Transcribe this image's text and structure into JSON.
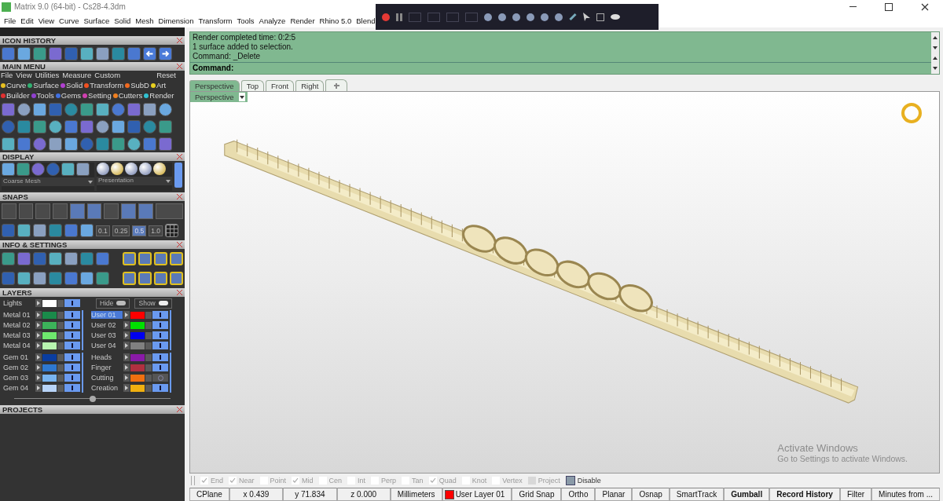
{
  "window": {
    "title": "Matrix 9.0 (64-bit) - Cs28-4.3dm"
  },
  "menu": [
    "File",
    "Edit",
    "View",
    "Curve",
    "Surface",
    "Solid",
    "Mesh",
    "Dimension",
    "Transform",
    "Tools",
    "Analyze",
    "Render",
    "Rhino 5.0",
    "Blend"
  ],
  "panels": {
    "icon_history": "ICON HISTORY",
    "main_menu": "MAIN MENU",
    "display": "DISPLAY",
    "snaps": "SNAPS",
    "info": "INFO & SETTINGS",
    "layers": "LAYERS",
    "projects": "PROJECTS"
  },
  "main_menu": {
    "submenu": [
      "File",
      "View",
      "Utilities",
      "Measure",
      "Custom"
    ],
    "reset": "Reset",
    "categories": [
      {
        "label": "Curve",
        "color": "#e8c020"
      },
      {
        "label": "Surface",
        "color": "#30b070"
      },
      {
        "label": "Solid",
        "color": "#b040d0"
      },
      {
        "label": "Transform",
        "color": "#f05020"
      },
      {
        "label": "SubD",
        "color": "#f06a20"
      },
      {
        "label": "Art",
        "color": "#e8d020"
      },
      {
        "label": "Builder",
        "color": "#e03030"
      },
      {
        "label": "Tools",
        "color": "#9040d0"
      },
      {
        "label": "Gems",
        "color": "#4070e0"
      },
      {
        "label": "Setting",
        "color": "#d040b0"
      },
      {
        "label": "Cutters",
        "color": "#f08020"
      },
      {
        "label": "Render",
        "color": "#30c0d0"
      }
    ]
  },
  "display": {
    "mesh": "Coarse Mesh",
    "mode": "Presentation"
  },
  "snaps": {
    "values": [
      {
        "label": "0.1",
        "selected": false
      },
      {
        "label": "0.25",
        "selected": false
      },
      {
        "label": "0.5",
        "selected": true
      },
      {
        "label": "1.0",
        "selected": false
      }
    ]
  },
  "layers": {
    "lights": {
      "name": "Lights",
      "color": "#ffffff",
      "on": true
    },
    "hide": "Hide",
    "show": "Show",
    "blocks": [
      {
        "left": [
          {
            "name": "Metal 01",
            "color": "#1a8a4a",
            "selected": false,
            "on": true
          },
          {
            "name": "Metal 02",
            "color": "#3cb35a",
            "selected": false,
            "on": true
          },
          {
            "name": "Metal 03",
            "color": "#6ee86e",
            "selected": false,
            "on": true
          },
          {
            "name": "Metal 04",
            "color": "#b8f5b0",
            "selected": false,
            "on": true
          }
        ],
        "right": [
          {
            "name": "User 01",
            "color": "#ff0000",
            "selected": true,
            "on": true
          },
          {
            "name": "User 02",
            "color": "#00e000",
            "selected": false,
            "on": true
          },
          {
            "name": "User 03",
            "color": "#0000f0",
            "selected": false,
            "on": true
          },
          {
            "name": "User 04",
            "color": "#808080",
            "selected": false,
            "on": true
          }
        ]
      },
      {
        "left": [
          {
            "name": "Gem 01",
            "color": "#0a3da0",
            "selected": false,
            "on": true
          },
          {
            "name": "Gem 02",
            "color": "#2e78d0",
            "selected": false,
            "on": true
          },
          {
            "name": "Gem 03",
            "color": "#78b4f0",
            "selected": false,
            "on": true
          },
          {
            "name": "Gem 04",
            "color": "#b8d4f8",
            "selected": false,
            "on": true
          }
        ],
        "right": [
          {
            "name": "Heads",
            "color": "#8a1aa8",
            "selected": false,
            "on": true
          },
          {
            "name": "Finger",
            "color": "#b03040",
            "selected": false,
            "on": true
          },
          {
            "name": "Cutting",
            "color": "#f07010",
            "selected": false,
            "on": false
          },
          {
            "name": "Creation",
            "color": "#f0b010",
            "selected": false,
            "on": true
          }
        ]
      }
    ]
  },
  "command": {
    "history": [
      "Render completed time: 0:2:5",
      "1 surface added to selection.",
      "Command: _Delete"
    ],
    "prompt": "Command:"
  },
  "tabs": [
    {
      "label": "Perspective",
      "selected": true
    },
    {
      "label": "Top",
      "selected": false
    },
    {
      "label": "Front",
      "selected": false
    },
    {
      "label": "Right",
      "selected": false
    }
  ],
  "viewport": {
    "label": "Perspective"
  },
  "osnaps": [
    {
      "label": "End",
      "kind": "osnap",
      "checked": true
    },
    {
      "label": "Near",
      "kind": "osnap",
      "checked": true
    },
    {
      "label": "Point",
      "kind": "osnap",
      "checked": false
    },
    {
      "label": "Mid",
      "kind": "osnap",
      "checked": true
    },
    {
      "label": "Cen",
      "kind": "osnap",
      "checked": false
    },
    {
      "label": "Int",
      "kind": "osnap",
      "checked": false
    },
    {
      "label": "Perp",
      "kind": "osnap",
      "checked": false
    },
    {
      "label": "Tan",
      "kind": "osnap",
      "checked": false
    },
    {
      "label": "Quad",
      "kind": "osnap",
      "checked": true
    },
    {
      "label": "Knot",
      "kind": "osnap",
      "checked": false
    },
    {
      "label": "Vertex",
      "kind": "osnap",
      "checked": false
    },
    {
      "label": "Project",
      "kind": "project",
      "checked": false
    },
    {
      "label": "Disable",
      "kind": "disable",
      "checked": false
    }
  ],
  "activation_notice": {
    "title": "Activate Windows",
    "text": "Go to Settings to activate Windows."
  },
  "status": {
    "cplane": "CPlane",
    "x": "x 0.439",
    "y": "y 71.834",
    "z": "z 0.000",
    "units": "Millimeters",
    "layer": {
      "name": "User Layer 01",
      "color": "#ff0000"
    },
    "toggles": [
      {
        "label": "Grid Snap",
        "on": false
      },
      {
        "label": "Ortho",
        "on": false
      },
      {
        "label": "Planar",
        "on": false
      },
      {
        "label": "Osnap",
        "on": false
      },
      {
        "label": "SmartTrack",
        "on": false
      },
      {
        "label": "Gumball",
        "on": true
      },
      {
        "label": "Record History",
        "on": true
      },
      {
        "label": "Filter",
        "on": false
      }
    ],
    "info": "Minutes from ..."
  }
}
